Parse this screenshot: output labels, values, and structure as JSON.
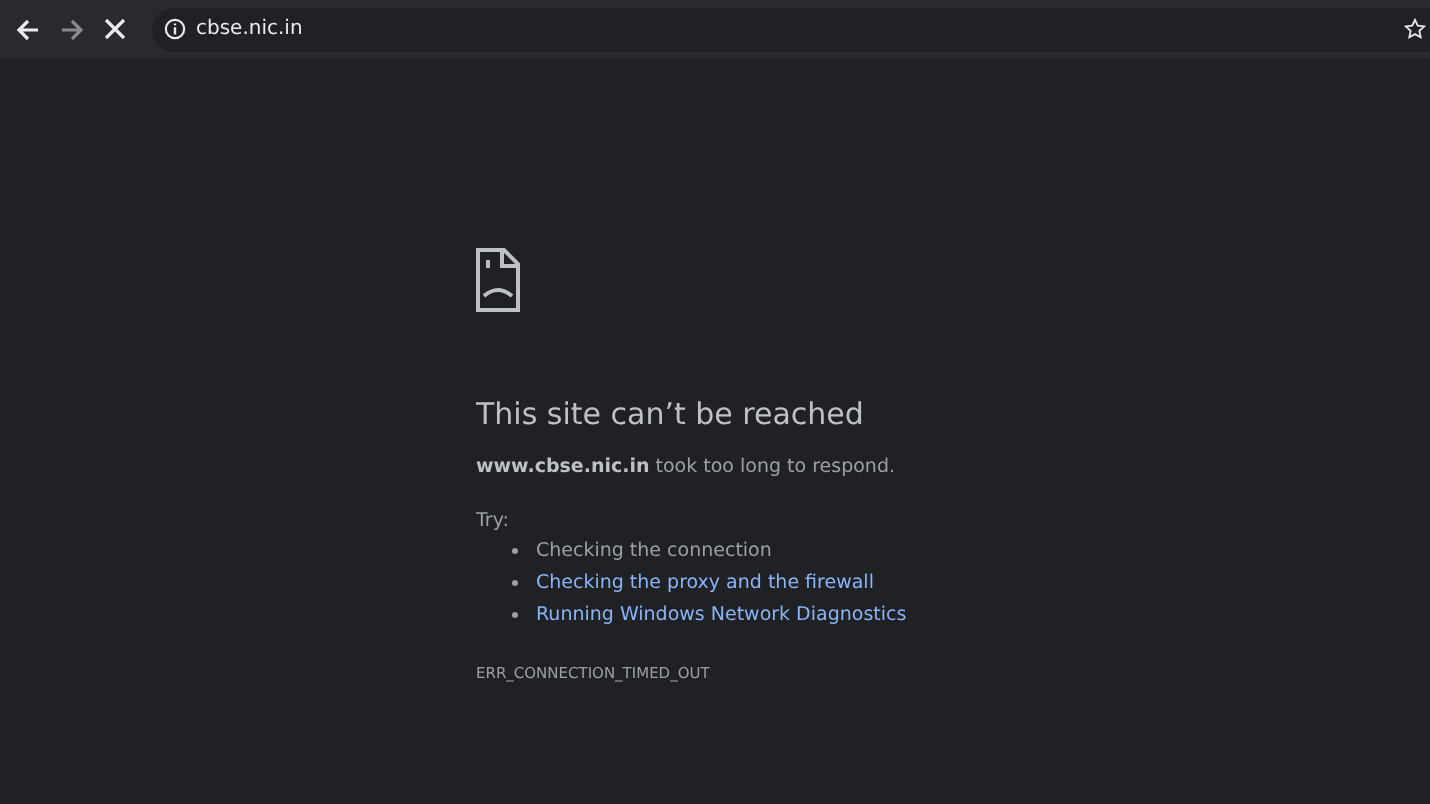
{
  "toolbar": {
    "url": "cbse.nic.in"
  },
  "error": {
    "title": "This site can’t be reached",
    "message": "**www.cbse.nic.in** took too long to respond.",
    "try_label": "Try:",
    "suggestions": [
      {
        "kind": "text",
        "text": "Checking the connection"
      },
      {
        "kind": "link",
        "text": "Checking the proxy and the firewall"
      },
      {
        "kind": "link",
        "text": "Running Windows Network Diagnostics"
      }
    ],
    "code": "ERR_CONNECTION_TIMED_OUT"
  }
}
